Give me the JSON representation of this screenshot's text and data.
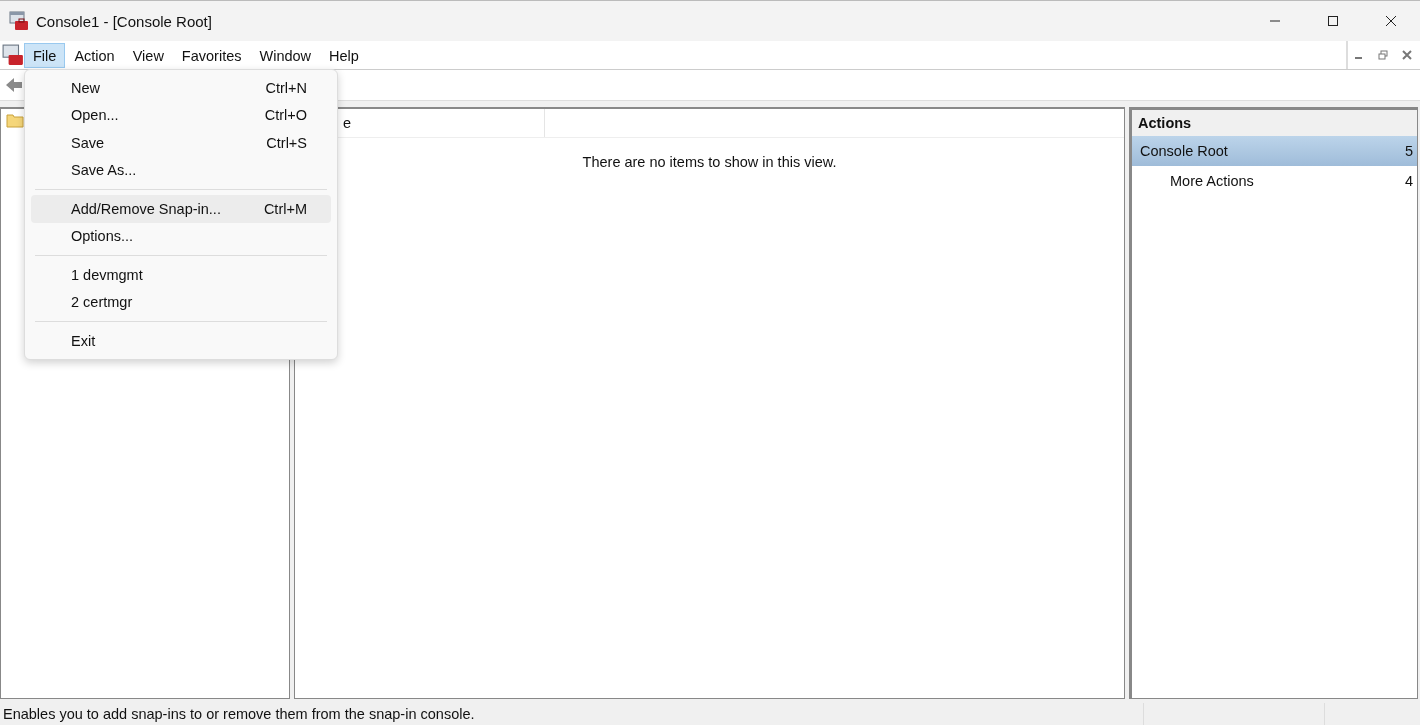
{
  "window": {
    "title": "Console1 - [Console Root]"
  },
  "menu_bar": [
    {
      "label": "File",
      "selected": true
    },
    {
      "label": "Action",
      "selected": false
    },
    {
      "label": "View",
      "selected": false
    },
    {
      "label": "Favorites",
      "selected": false
    },
    {
      "label": "Window",
      "selected": false
    },
    {
      "label": "Help",
      "selected": false
    }
  ],
  "file_menu": [
    {
      "kind": "item",
      "label": "New",
      "shortcut": "Ctrl+N",
      "selected": false
    },
    {
      "kind": "item",
      "label": "Open...",
      "shortcut": "Ctrl+O",
      "selected": false
    },
    {
      "kind": "item",
      "label": "Save",
      "shortcut": "Ctrl+S",
      "selected": false
    },
    {
      "kind": "item",
      "label": "Save As...",
      "selected": false
    },
    {
      "kind": "separator"
    },
    {
      "kind": "item",
      "label": "Add/Remove Snap-in...",
      "shortcut": "Ctrl+M",
      "selected": true
    },
    {
      "kind": "item",
      "label": "Options...",
      "selected": false
    },
    {
      "kind": "separator"
    },
    {
      "kind": "item",
      "label": "1 devmgmt",
      "selected": false
    },
    {
      "kind": "item",
      "label": "2 certmgr",
      "selected": false
    },
    {
      "kind": "separator"
    },
    {
      "kind": "item",
      "label": "Exit",
      "selected": false
    }
  ],
  "list_view": {
    "column_1": "e",
    "empty_message": "There are no items to show in this view."
  },
  "actions_pane": {
    "title": "Actions",
    "items": [
      {
        "label": "Console Root",
        "glyph": "5",
        "selected": true,
        "indented": false
      },
      {
        "label": "More Actions",
        "glyph": "4",
        "selected": false,
        "indented": true
      }
    ]
  },
  "status_bar": {
    "text": "Enables you to add snap-ins to or remove them from the snap-in console."
  }
}
